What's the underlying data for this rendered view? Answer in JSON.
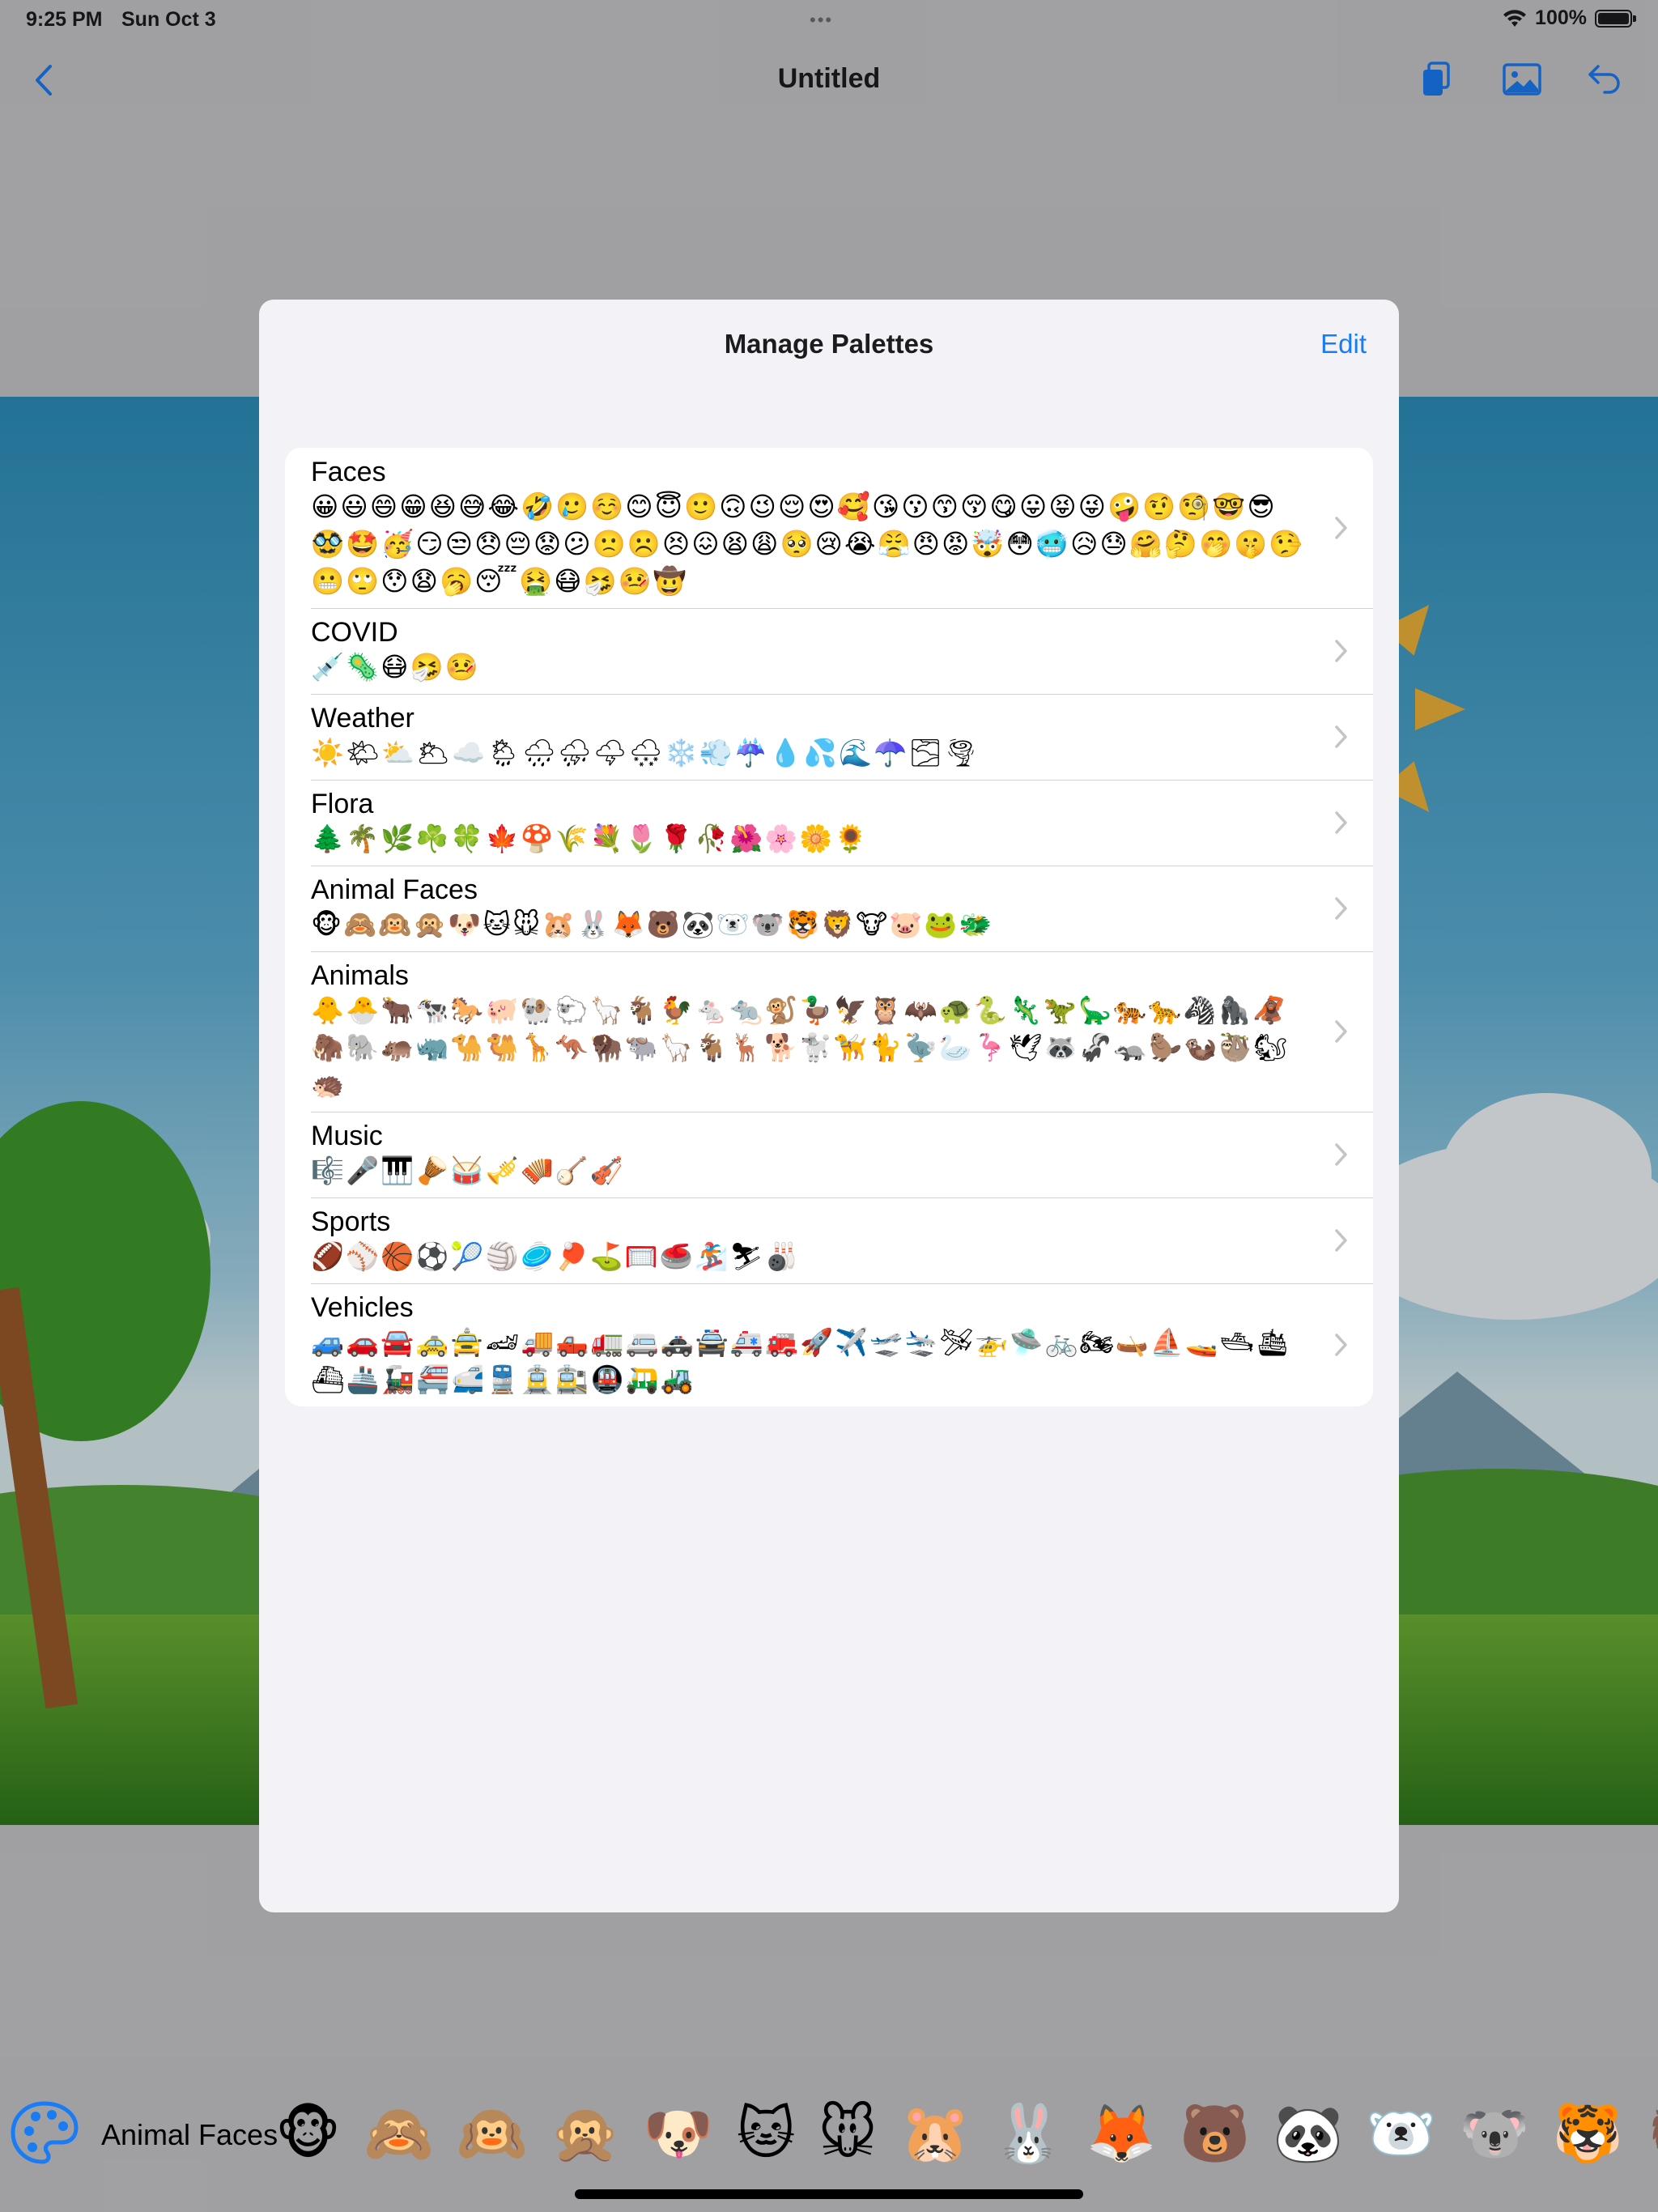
{
  "status": {
    "time": "9:25 PM",
    "date": "Sun Oct 3",
    "battery": "100%",
    "dots": "•••"
  },
  "nav": {
    "title": "Untitled"
  },
  "sheet": {
    "title": "Manage Palettes",
    "edit_label": "Edit",
    "palettes": [
      {
        "name": "Faces",
        "emojis": "😀😃😄😁😆😅😂🤣🥲☺️😊😇🙂🙃😉😌😍🥰😘😗😙😚😋😛😝😜🤪🤨🧐🤓😎🥸🤩🥳😏😒😞😔😟😕🙁☹️😣😖😫😩🥺😢😭😤😠😡🤯😳🥶😥😓🤗🤔🤭🤫🤥😬🙄😯😧🥱😴🤮😷🤧🤒🤠"
      },
      {
        "name": "COVID",
        "emojis": "💉🦠😷🤧🤒"
      },
      {
        "name": "Weather",
        "emojis": "☀️🌤⛅️🌥☁️🌦🌧⛈🌩🌨❄️💨☔️💧💦🌊☂️🌫🌪"
      },
      {
        "name": "Flora",
        "emojis": "🌲🌴🌿☘️🍀🍁🍄🌾💐🌷🌹🥀🌺🌸🌼🌻"
      },
      {
        "name": "Animal Faces",
        "emojis": "🐵🙈🙉🙊🐶🐱🐭🐹🐰🦊🐻🐼🐻‍❄️🐨🐯🦁🐮🐷🐸🐲"
      },
      {
        "name": "Animals",
        "emojis": "🐥🐣🐂🐄🐎🐖🐏🐑🦙🐐🐓🐁🐀🐒🦆🦅🦉🦇🐢🐍🦎🦖🦕🐅🐆🦓🦍🦧🦣🐘🦛🦏🐪🐫🦒🦘🦬🐃🦙🐐🦌🐕🐩🦮🐈🦤🦢🦩🕊🦝🦨🦡🦫🦦🦥🐿🦔"
      },
      {
        "name": "Music",
        "emojis": "🎼🎤🎹🪘🥁🎺🪗🪕🎻"
      },
      {
        "name": "Sports",
        "emojis": "🏈⚾️🏀⚽️🎾🏐🥏🏓⛳️🥅🥌🏂⛷🎳"
      },
      {
        "name": "Vehicles",
        "emojis": "🚙🚗🚘🚕🚖🏎🚚🛻🚛🚐🚓🚔🚑🚒🚀✈️🛫🛬🛩🚁🛸🚲🏍🛶⛵️🚤🛥🛳⛴🚢🚂🚝🚅🚆🚊🚉🚇🛺🚜"
      }
    ]
  },
  "bottombar": {
    "palette_name": "Animal Faces",
    "emojis": "🐵🙈🙉🙊🐶🐱🐭🐹🐰🦊🐻🐼🐻‍❄️🐨🐯🦁"
  },
  "colors": {
    "accent": "#1a7cf5",
    "sheet_bg": "#f2f2f7",
    "row_bg": "#ffffff"
  }
}
